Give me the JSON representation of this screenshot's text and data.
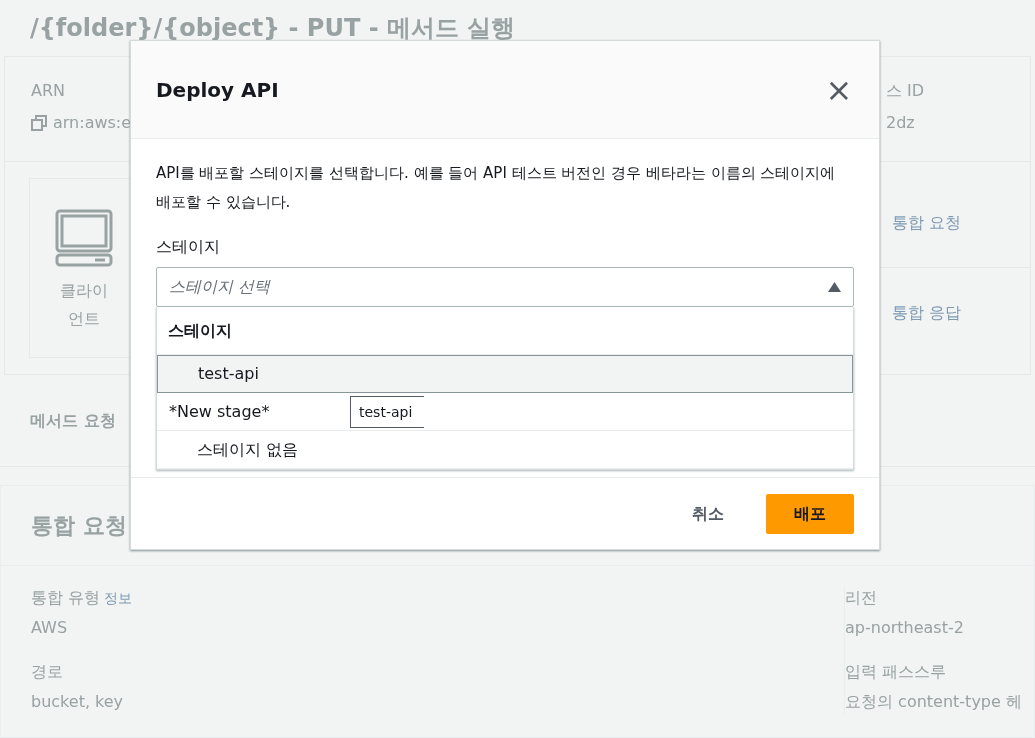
{
  "page": {
    "title": "/{folder}/{object} - PUT - 메서드 실행",
    "arn": {
      "label": "ARN",
      "value": "arn:aws:e"
    },
    "resource_id": {
      "label": "스 ID",
      "value": "2dz"
    },
    "client_label": "클라이언트",
    "flow_links": [
      "통합 요청",
      "통합 응답"
    ],
    "method_request": "메서드 요청",
    "integration": {
      "heading": "통합 요청",
      "left_fields": [
        {
          "label": "통합 유형",
          "info": "정보",
          "value": "AWS"
        },
        {
          "label": "경로",
          "value": "bucket, key"
        }
      ],
      "right_fields": [
        {
          "label": "리전",
          "value": "ap-northeast-2"
        },
        {
          "label": "입력 패스스루",
          "value": "요청의 content-type 헤"
        }
      ]
    }
  },
  "dialog": {
    "title": "Deploy API",
    "close": "×",
    "description": "API를 배포할 스테이지를 선택합니다. 예를 들어 API 테스트 버전인 경우 베타라는 이름의 스테이지에 배포할 수 있습니다.",
    "stage_label": "스테이지",
    "select": {
      "placeholder": "스테이지 선택",
      "expanded": true
    },
    "group_label": "스테이지",
    "options": [
      {
        "kind": "option",
        "label": "test-api",
        "selected": true
      },
      {
        "kind": "new",
        "label": "*New stage*",
        "value": "test-api",
        "selected": false
      },
      {
        "kind": "option",
        "label": "스테이지 없음",
        "selected": false
      }
    ],
    "buttons": {
      "cancel": "취소",
      "deploy": "배포"
    }
  }
}
